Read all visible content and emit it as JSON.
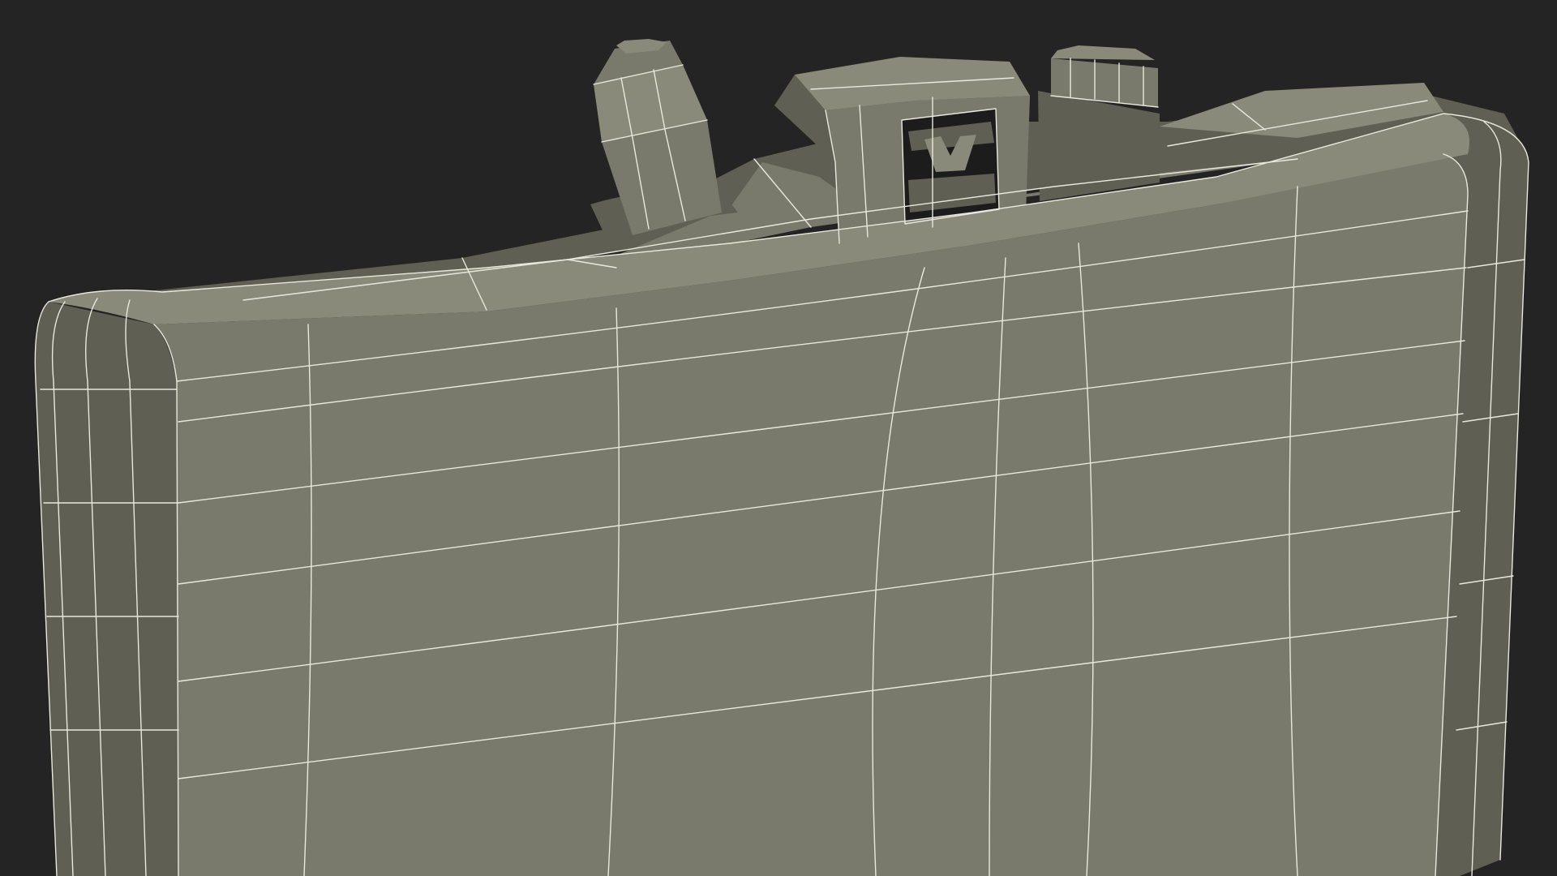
{
  "scene": {
    "subject": "wireframe-render",
    "colors": {
      "background": "#242424",
      "surface": "#7a7a6c",
      "surface_light": "#8a8a7b",
      "surface_dark": "#5f5f54",
      "shadow": "#1c1c1c",
      "wire": "#e8e8dc"
    }
  }
}
